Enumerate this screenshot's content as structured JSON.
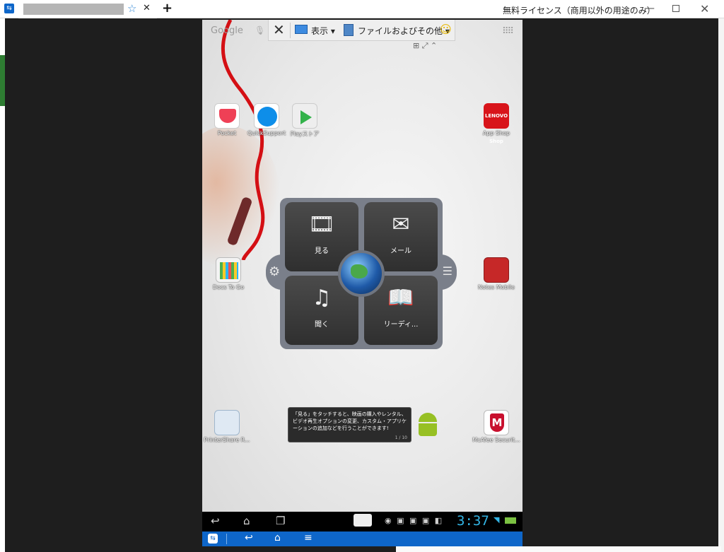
{
  "window": {
    "title": "無料ライセンス（商用以外の用途のみ）",
    "min_glyph": "—",
    "close_glyph": "✕",
    "tab_star": "☆",
    "tab_close": "✕",
    "new_tab": "+"
  },
  "toolbar": {
    "close_glyph": "✕",
    "view_label": "表示 ▾",
    "files_label": "ファイルおよびその他 ▾",
    "smile_glyph": "☺",
    "sub_icons": "⊞ ⤢ ⌃"
  },
  "home": {
    "google_label": "Google",
    "apps": [
      {
        "label": "Pocket"
      },
      {
        "label": "QuickSupport"
      },
      {
        "label": "Playストア"
      },
      {
        "label": "App Shop"
      },
      {
        "label": "Docs To Go"
      },
      {
        "label": "Notes Mobile"
      },
      {
        "label": "PrinterShare R..."
      },
      {
        "label": "McAfee Securit..."
      }
    ],
    "lenovo_badge": "LENOVO Shop"
  },
  "widget": {
    "tiles": [
      {
        "label": "見る",
        "icon": "film-icon"
      },
      {
        "label": "メール",
        "icon": "mail-icon"
      },
      {
        "label": "聞く",
        "icon": "music-note-icon"
      },
      {
        "label": "リーディ...",
        "icon": "book-icon"
      }
    ]
  },
  "tooltip": {
    "text": "「見る」をタッチすると、映画の購入やレンタル、ビデオ再生オプションの変更、カスタム・アプリケーションの追加などを行うことができます!",
    "counter": "1 / 10"
  },
  "statusbar": {
    "time": "3:37"
  },
  "colors": {
    "teamviewer_blue": "#0e66c9",
    "clock_blue": "#33b5e5",
    "widget_frame": "#7a7f8a"
  }
}
